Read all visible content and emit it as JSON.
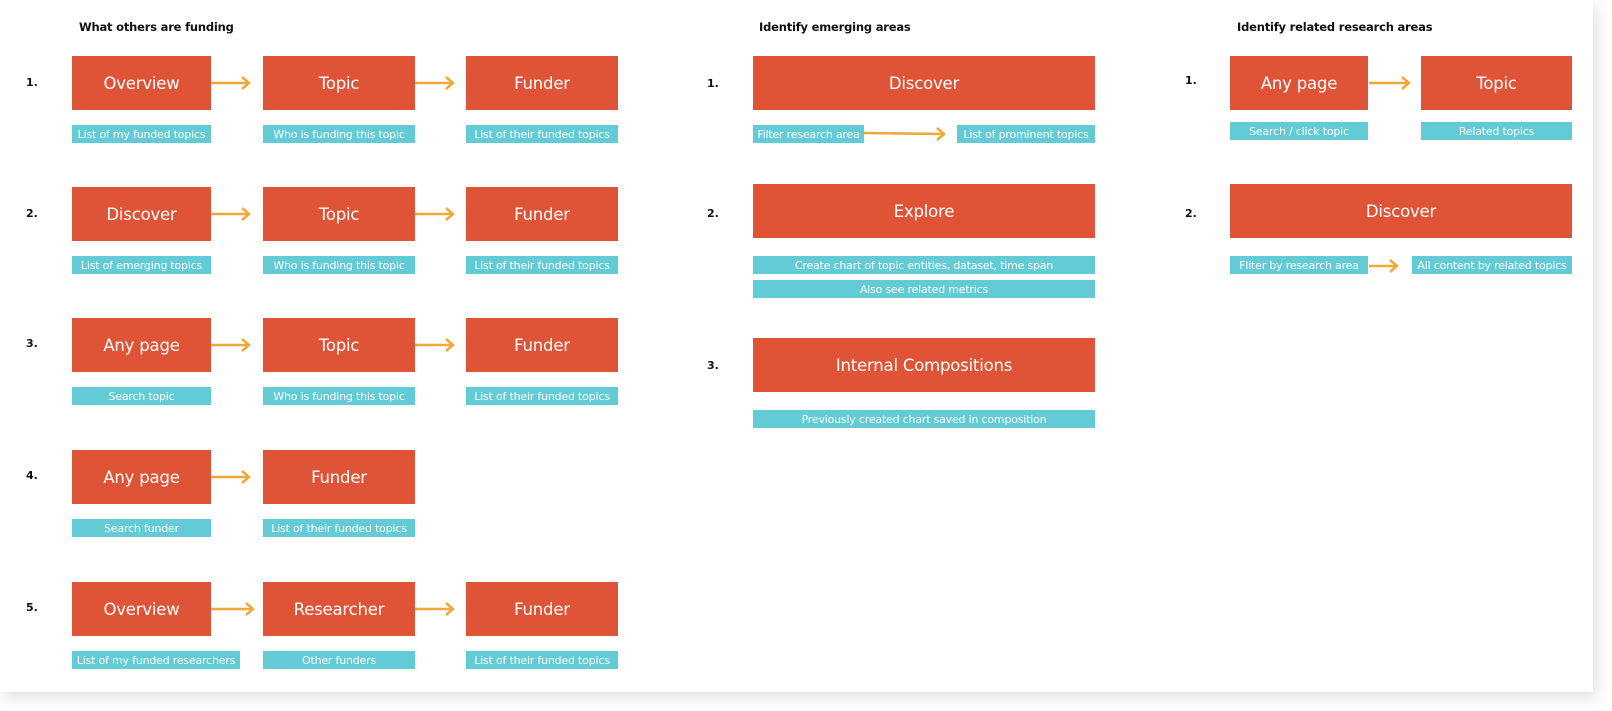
{
  "colors": {
    "step_box": "#df5437",
    "detail_tag": "#63cbd6",
    "arrow": "#f0a83a"
  },
  "sections": {
    "funding": {
      "title": "What others are funding",
      "flows": [
        {
          "number": "1.",
          "steps": [
            {
              "label": "Overview",
              "detail": "List of my funded topics"
            },
            {
              "label": "Topic",
              "detail": "Who is funding this topic"
            },
            {
              "label": "Funder",
              "detail": "List of their funded topics"
            }
          ]
        },
        {
          "number": "2.",
          "steps": [
            {
              "label": "Discover",
              "detail": "List of emerging topics"
            },
            {
              "label": "Topic",
              "detail": "Who is funding this topic"
            },
            {
              "label": "Funder",
              "detail": "List of their funded topics"
            }
          ]
        },
        {
          "number": "3.",
          "steps": [
            {
              "label": "Any page",
              "detail": "Search topic"
            },
            {
              "label": "Topic",
              "detail": "Who is funding this topic"
            },
            {
              "label": "Funder",
              "detail": "List of their funded topics"
            }
          ]
        },
        {
          "number": "4.",
          "steps": [
            {
              "label": "Any page",
              "detail": "Search funder"
            },
            {
              "label": "Funder",
              "detail": "List of their funded topics"
            }
          ]
        },
        {
          "number": "5.",
          "steps": [
            {
              "label": "Overview",
              "detail": "List of my funded researchers"
            },
            {
              "label": "Researcher",
              "detail": "Other funders"
            },
            {
              "label": "Funder",
              "detail": "List of their funded topics"
            }
          ]
        }
      ]
    },
    "emerging": {
      "title": "Identify emerging areas",
      "flows": [
        {
          "number": "1.",
          "label": "Discover",
          "details": [
            "Filter research area",
            "List of prominent topics"
          ]
        },
        {
          "number": "2.",
          "label": "Explore",
          "details": [
            "Create chart of topic entities, dataset, time span",
            "Also see related metrics"
          ]
        },
        {
          "number": "3.",
          "label": "Internal Compositions",
          "details": [
            "Previously created chart saved in composition"
          ]
        }
      ]
    },
    "related": {
      "title": "Identify related research areas",
      "flows": [
        {
          "number": "1.",
          "steps": [
            {
              "label": "Any page",
              "detail": "Search / click topic"
            },
            {
              "label": "Topic",
              "detail": "Related topics"
            }
          ]
        },
        {
          "number": "2.",
          "label": "Discover",
          "details": [
            "Fliter by research area",
            "All content by related topics"
          ]
        }
      ]
    }
  }
}
